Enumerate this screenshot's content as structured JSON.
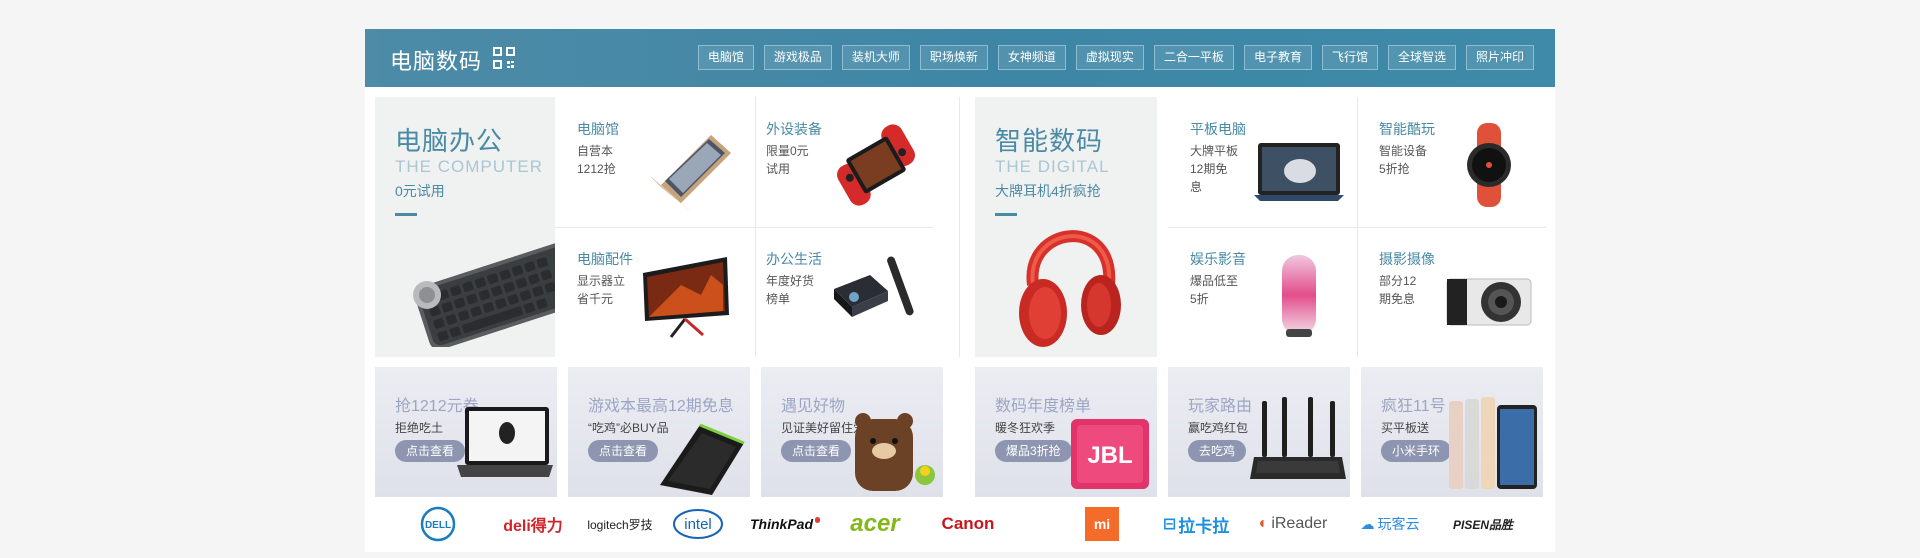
{
  "header": {
    "title": "电脑数码",
    "tabs": [
      "电脑馆",
      "游戏极品",
      "装机大师",
      "职场焕新",
      "女神频道",
      "虚拟现实",
      "二合一平板",
      "电子教育",
      "飞行馆",
      "全球智选",
      "照片冲印"
    ]
  },
  "left_big": {
    "title": "电脑办公",
    "subtitle_en": "THE COMPUTER",
    "promo": "0元试用",
    "image": "keyboard-image"
  },
  "right_big": {
    "title": "智能数码",
    "subtitle_en": "THE DIGITAL",
    "promo": "大牌耳机4折疯抢",
    "image": "headphones-image"
  },
  "left_cells": [
    {
      "title": "电脑馆",
      "desc": "自营本1212抢",
      "image": "laptop-image"
    },
    {
      "title": "外设装备",
      "desc": "限量0元试用",
      "image": "gamepad-image"
    },
    {
      "title": "电脑配件",
      "desc": "显示器立省千元",
      "image": "monitor-image"
    },
    {
      "title": "办公生活",
      "desc": "年度好货榜单",
      "image": "projector-image"
    }
  ],
  "right_cells": [
    {
      "title": "平板电脑",
      "desc": "大牌平板12期免息",
      "image": "tablet-image"
    },
    {
      "title": "智能酷玩",
      "desc": "智能设备5折抢",
      "image": "smartwatch-image"
    },
    {
      "title": "娱乐影音",
      "desc": "爆品低至5折",
      "image": "speaker-image"
    },
    {
      "title": "摄影摄像",
      "desc": "部分12期免息",
      "image": "camera-image"
    }
  ],
  "banners": [
    {
      "title": "抢1212元券",
      "sub": "拒绝吃土",
      "btn": "点击查看",
      "image": "alienware-laptop-image"
    },
    {
      "title": "游戏本最高12期免息",
      "sub": "“吃鸡”必BUY品",
      "btn": "点击查看",
      "image": "gaming-laptop-image"
    },
    {
      "title": "遇见好物",
      "sub": "见证美好留住爱",
      "btn": "点击查看",
      "image": "brown-bear-image"
    },
    {
      "title": "数码年度榜单",
      "sub": "暖冬狂欢季",
      "btn": "爆品3折抢",
      "image": "jbl-speaker-image"
    },
    {
      "title": "玩家路由",
      "sub": "赢吃鸡红包",
      "btn": "去吃鸡",
      "image": "router-image"
    },
    {
      "title": "疯狂11号",
      "sub": "买平板送",
      "btn": "小米手环",
      "image": "ipad-image"
    }
  ],
  "brands": [
    {
      "name": "DELL",
      "color": "#1a7bbf"
    },
    {
      "name": "deli得力",
      "color": "#d2232a"
    },
    {
      "name": "logitech罗技",
      "color": "#222222"
    },
    {
      "name": "intel",
      "color": "#1565b5"
    },
    {
      "name": "ThinkPad",
      "color": "#111111"
    },
    {
      "name": "acer",
      "color": "#83b81a"
    },
    {
      "name": "Canon",
      "color": "#c8161d"
    },
    {
      "name": "mi",
      "color": "#f56b2a"
    },
    {
      "name": "拉卡拉",
      "color": "#1a8fe0"
    },
    {
      "name": "iReader",
      "color": "#555555"
    },
    {
      "name": "玩客云",
      "color": "#2e8de0"
    },
    {
      "name": "PISEN品胜",
      "color": "#222222"
    }
  ],
  "colors": {
    "accent": "#4a8aa5",
    "header_bg": "#3f86a6",
    "banner_btn": "#8e95b1"
  }
}
